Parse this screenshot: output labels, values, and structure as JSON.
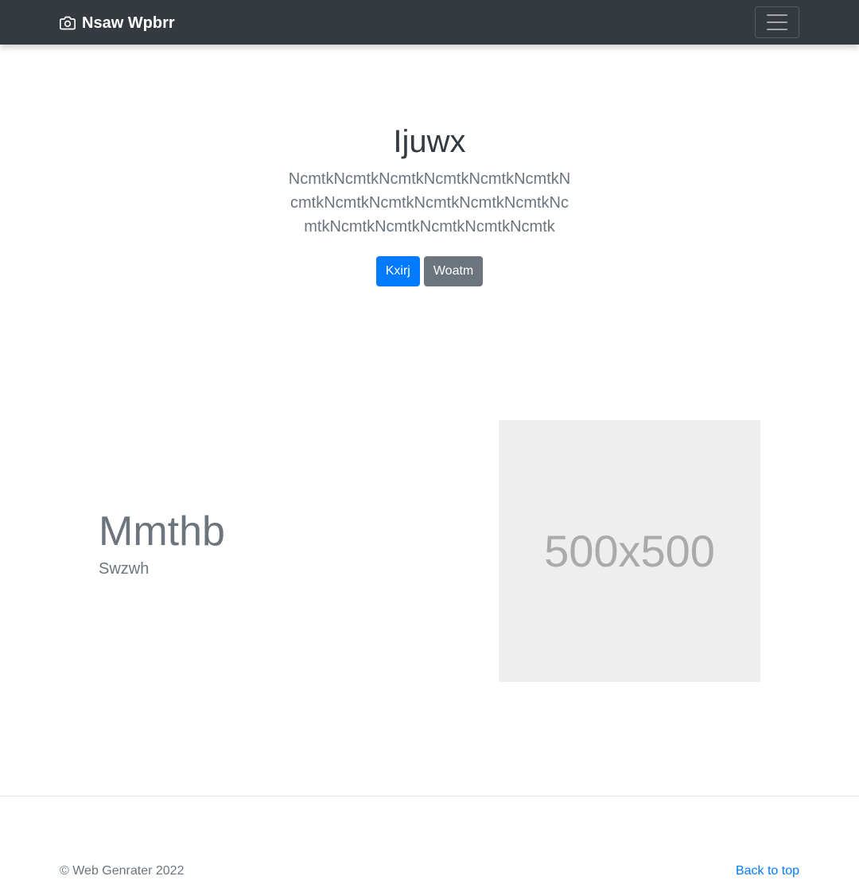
{
  "navbar": {
    "brand_icon": "camera-icon",
    "brand": "Nsaw Wpbrr",
    "toggler_icon": "hamburger-menu-icon"
  },
  "hero": {
    "title": "Ijuwx",
    "lead": "NcmtkNcmtkNcmtkNcmtkNcmtkNcmtkNcmtkNcmtkNcmtkNcmtkNcmtkNcmtkNcmtkNcmtkNcmtkNcmtkNcmtkNcmtk",
    "primary_button": "Kxirj",
    "secondary_button": "Woatm"
  },
  "feature": {
    "title": "Mmthb",
    "subtitle": "Swzwh",
    "image_label": "500x500"
  },
  "footer": {
    "copyright": "© Web Genrater 2022",
    "back_to_top": "Back to top"
  },
  "colors": {
    "navbar_bg": "#343a40",
    "primary": "#007bff",
    "secondary": "#6c757d",
    "placeholder_bg": "#eeeeee"
  }
}
